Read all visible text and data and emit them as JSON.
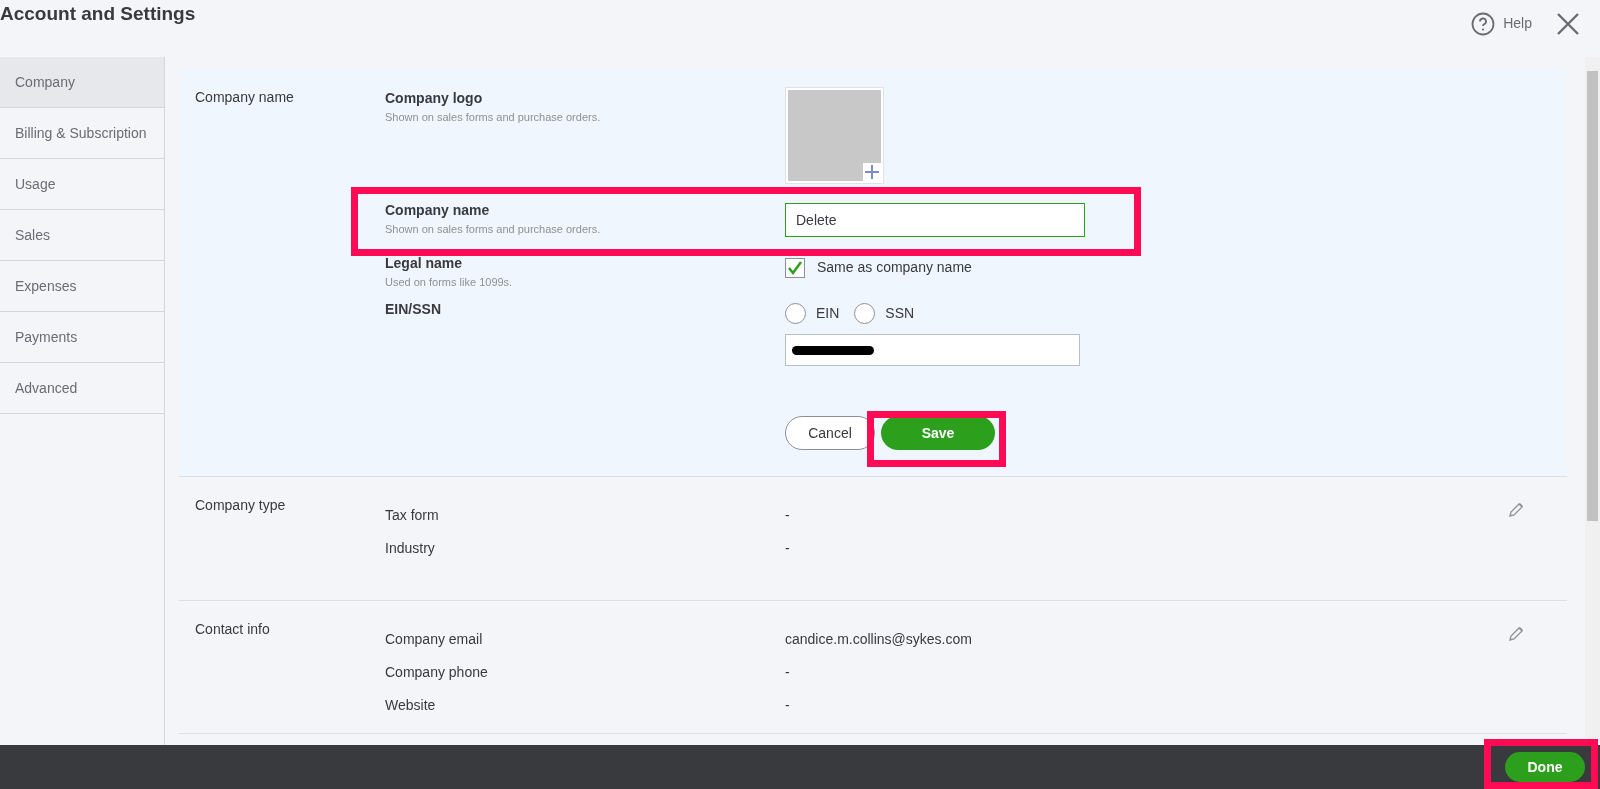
{
  "window": {
    "title": "Account and Settings",
    "help": "Help"
  },
  "sidebar": {
    "items": [
      {
        "label": "Company",
        "selected": true
      },
      {
        "label": "Billing & Subscription",
        "selected": false
      },
      {
        "label": "Usage",
        "selected": false
      },
      {
        "label": "Sales",
        "selected": false
      },
      {
        "label": "Expenses",
        "selected": false
      },
      {
        "label": "Payments",
        "selected": false
      },
      {
        "label": "Advanced",
        "selected": false
      }
    ]
  },
  "company_name_section": {
    "label": "Company name",
    "logo": {
      "title": "Company logo",
      "hint": "Shown on sales forms and purchase orders."
    },
    "name": {
      "title": "Company name",
      "hint": "Shown on sales forms and purchase orders.",
      "value": "Delete",
      "highlighted": true
    },
    "legal": {
      "title": "Legal name",
      "hint": "Used on forms like 1099s.",
      "checkbox_label": "Same as company name",
      "checked": true
    },
    "ein": {
      "title": "EIN/SSN",
      "options": [
        {
          "label": "EIN",
          "selected": false
        },
        {
          "label": "SSN",
          "selected": false
        }
      ]
    },
    "cancel": "Cancel",
    "save": "Save",
    "save_highlighted": true
  },
  "sections": [
    {
      "label": "Company type",
      "rows": [
        {
          "name": "Tax form",
          "value": "-"
        },
        {
          "name": "Industry",
          "value": "-"
        }
      ]
    },
    {
      "label": "Contact info",
      "rows": [
        {
          "name": "Company email",
          "value": "candice.m.collins@sykes.com"
        },
        {
          "name": "Company phone",
          "value": "-"
        },
        {
          "name": "Website",
          "value": "-"
        }
      ]
    }
  ],
  "footer": {
    "done": "Done",
    "done_highlighted": true
  }
}
